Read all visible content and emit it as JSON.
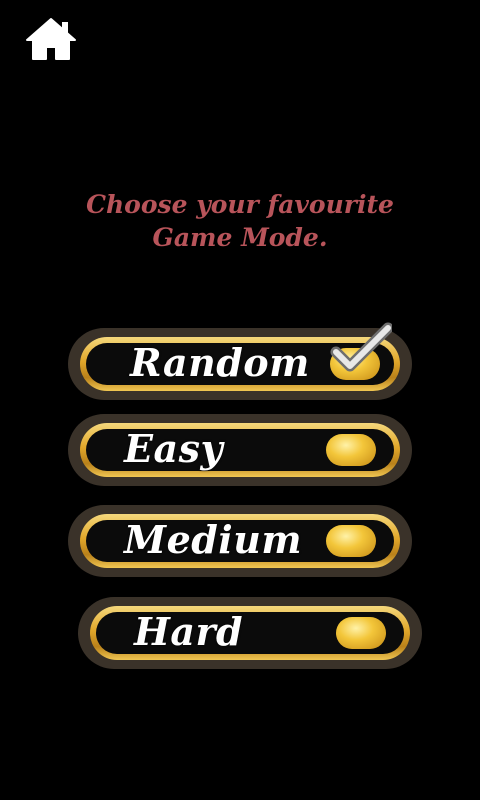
{
  "header": {
    "home_icon": "home-icon"
  },
  "prompt": {
    "line1": "Choose your favourite",
    "line2": "Game Mode."
  },
  "modes": [
    {
      "label": "Random",
      "selected": true
    },
    {
      "label": "Easy",
      "selected": false
    },
    {
      "label": "Medium",
      "selected": false
    },
    {
      "label": "Hard",
      "selected": false
    }
  ],
  "colors": {
    "background": "#000000",
    "prompt_text": "#b8545a",
    "button_outer": "#3a3229",
    "gold": "#e2a72a",
    "label_text": "#ffffff"
  },
  "icons": {
    "selected_marker": "checkmark-icon",
    "unselected_marker": "gold-dot-icon"
  }
}
